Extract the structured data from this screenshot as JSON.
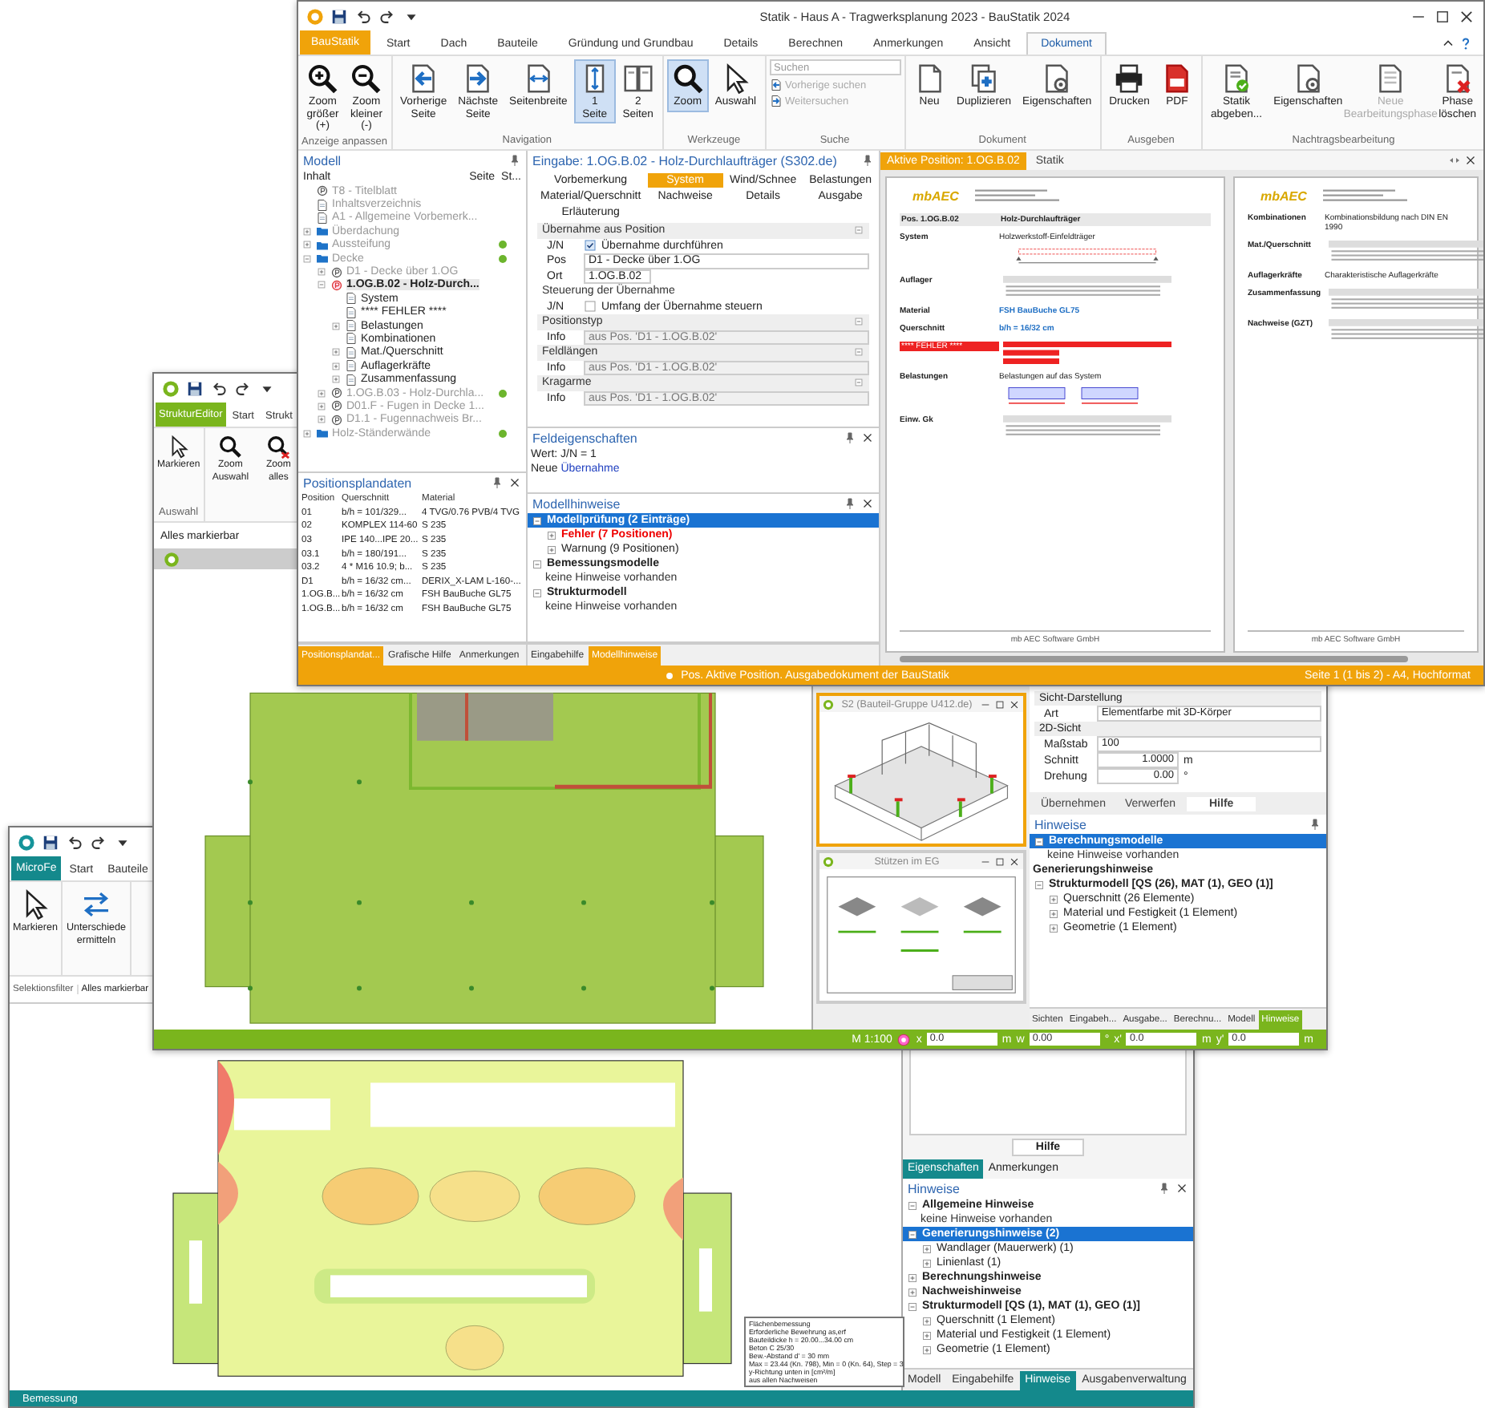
{
  "statik_window": {
    "title": "Statik - Haus A - Tragwerksplanung 2023 - BauStatik 2024",
    "app_tab": "BauStatik",
    "tabs": [
      {
        "label": "Start",
        "selected": false
      },
      {
        "label": "Dach",
        "selected": false
      },
      {
        "label": "Bauteile",
        "selected": false
      },
      {
        "label": "Gründung und Grundbau",
        "selected": false
      },
      {
        "label": "Details",
        "selected": false
      },
      {
        "label": "Berechnen",
        "selected": false
      },
      {
        "label": "Anmerkungen",
        "selected": false
      },
      {
        "label": "Ansicht",
        "selected": false
      },
      {
        "label": "Dokument",
        "selected": true
      }
    ],
    "ribbon": [
      {
        "group": "Anzeige anpassen",
        "items": [
          {
            "kind": "big",
            "label": "Zoom größer (+)",
            "selected": false,
            "disabled": false
          },
          {
            "kind": "big",
            "label": "Zoom kleiner (-)",
            "selected": false,
            "disabled": false
          }
        ]
      },
      {
        "group": "Navigation",
        "items": [
          {
            "kind": "big",
            "label": "Vorherige Seite",
            "selected": false,
            "disabled": false
          },
          {
            "kind": "big",
            "label": "Nächste Seite",
            "selected": false,
            "disabled": false
          },
          {
            "kind": "big",
            "label": "Seitenbreite",
            "selected": false,
            "disabled": false
          },
          {
            "kind": "big",
            "label": "1 Seite",
            "selected": true,
            "disabled": false
          },
          {
            "kind": "big",
            "label": "2 Seiten",
            "selected": false,
            "disabled": false
          }
        ]
      },
      {
        "group": "Werkzeuge",
        "items": [
          {
            "kind": "big",
            "label": "Zoom",
            "selected": true,
            "disabled": false
          },
          {
            "kind": "big",
            "label": "Auswahl",
            "selected": false,
            "disabled": false
          }
        ]
      },
      {
        "group": "Suche",
        "items": [
          {
            "kind": "field",
            "placeholder": "Suchen"
          },
          {
            "kind": "small",
            "label": "Vorherige suchen",
            "disabled": true
          },
          {
            "kind": "small",
            "label": "Weitersuchen",
            "disabled": true
          }
        ]
      },
      {
        "group": "Dokument",
        "items": [
          {
            "kind": "big",
            "label": "Neu",
            "selected": false,
            "disabled": false
          },
          {
            "kind": "big",
            "label": "Duplizieren",
            "selected": false,
            "disabled": false
          },
          {
            "kind": "big",
            "label": "Eigenschaften",
            "selected": false,
            "disabled": false
          }
        ]
      },
      {
        "group": "Ausgeben",
        "items": [
          {
            "kind": "big",
            "label": "Drucken",
            "selected": false,
            "disabled": false
          },
          {
            "kind": "big",
            "label": "PDF",
            "selected": false,
            "disabled": false
          }
        ]
      },
      {
        "group": "Nachtragsbearbeitung",
        "items": [
          {
            "kind": "big",
            "label": "Statik abgeben...",
            "selected": false,
            "disabled": false
          },
          {
            "kind": "big",
            "label": "Eigenschaften",
            "selected": false,
            "disabled": false
          },
          {
            "kind": "big",
            "label": "Neue Bearbeitungsphase",
            "selected": false,
            "disabled": true
          },
          {
            "kind": "big",
            "label": "Phase löschen",
            "selected": false,
            "disabled": false
          }
        ]
      }
    ],
    "model": {
      "title": "Modell",
      "columns": [
        "Inhalt",
        "Seite",
        "St..."
      ],
      "items": [
        {
          "label": "T8 - Titelblatt",
          "kind": "position",
          "dimmed": true,
          "selected": false
        },
        {
          "label": "Inhaltsverzeichnis",
          "kind": "page",
          "dimmed": true,
          "selected": false
        },
        {
          "label": "A1 - Allgemeine Vorbemerk...",
          "kind": "page",
          "dimmed": true,
          "selected": false
        },
        {
          "label": "Überdachung",
          "kind": "folder",
          "dimmed": true,
          "selected": false,
          "expanded": false
        },
        {
          "label": "Aussteifung",
          "kind": "folder",
          "dimmed": true,
          "selected": false,
          "expanded": false,
          "ok": true
        },
        {
          "label": "Decke",
          "kind": "folder",
          "dimmed": true,
          "selected": false,
          "expanded": true,
          "ok": true,
          "children": [
            {
              "label": "D1 - Decke über 1.OG",
              "kind": "position",
              "dimmed": true,
              "selected": false,
              "expanded": false
            },
            {
              "label": "1.OG.B.02 - Holz-Durch...",
              "kind": "faulty",
              "dimmed": false,
              "selected": true,
              "expanded": true,
              "children": [
                {
                  "label": "System",
                  "kind": "page",
                  "dimmed": false,
                  "selected": false
                },
                {
                  "label": "**** FEHLER ****",
                  "kind": "page",
                  "dimmed": false,
                  "selected": false
                },
                {
                  "label": "Belastungen",
                  "kind": "page",
                  "dimmed": false,
                  "selected": false,
                  "expanded": false
                },
                {
                  "label": "Kombinationen",
                  "kind": "page",
                  "dimmed": false,
                  "selected": false
                },
                {
                  "label": "Mat./Querschnitt",
                  "kind": "page",
                  "dimmed": false,
                  "selected": false,
                  "expanded": false
                },
                {
                  "label": "Auflagerkräfte",
                  "kind": "page",
                  "dimmed": false,
                  "selected": false,
                  "expanded": false
                },
                {
                  "label": "Zusammenfassung",
                  "kind": "page",
                  "dimmed": false,
                  "selected": false,
                  "expanded": false
                }
              ]
            },
            {
              "label": "1.OG.B.03 - Holz-Durchla...",
              "kind": "position",
              "dimmed": true,
              "selected": false,
              "expanded": false,
              "ok": true
            },
            {
              "label": "D01.F - Fugen in Decke 1...",
              "kind": "position",
              "dimmed": true,
              "selected": false,
              "expanded": false
            },
            {
              "label": "D1.1 - Fugennachweis Br...",
              "kind": "position",
              "dimmed": true,
              "selected": false,
              "expanded": false
            }
          ]
        },
        {
          "label": "Holz-Ständerwände",
          "kind": "folder",
          "dimmed": true,
          "selected": false,
          "expanded": false,
          "ok": true
        }
      ]
    },
    "input": {
      "title": "Eingabe: 1.OG.B.02 - Holz-Durchlaufträger (S302.de)",
      "tabs": [
        {
          "label": "Vorbemerkung",
          "selected": false
        },
        {
          "label": "System",
          "selected": true
        },
        {
          "label": "Wind/Schnee",
          "selected": false
        },
        {
          "label": "Belastungen",
          "selected": false
        },
        {
          "label": "Material/Querschnitt",
          "selected": false
        },
        {
          "label": "Nachweise",
          "selected": false
        },
        {
          "label": "Details",
          "selected": false
        },
        {
          "label": "Ausgabe",
          "selected": false
        },
        {
          "label": "Erläuterung",
          "selected": false
        }
      ],
      "sections": [
        {
          "title": "Übernahme aus Position",
          "collapsible": true,
          "rows": [
            {
              "kind": "check",
              "label": "J/N",
              "text": "Übernahme durchführen",
              "checked": true
            },
            {
              "kind": "select",
              "label": "Pos",
              "value": "D1 - Decke über 1.OG"
            },
            {
              "kind": "select-short",
              "label": "Ort",
              "value": "1.OG.B.02"
            }
          ]
        },
        {
          "title": "Steuerung der Übernahme",
          "collapsible": false,
          "rows": [
            {
              "kind": "check",
              "label": "J/N",
              "text": "Umfang der Übernahme steuern",
              "checked": false
            }
          ]
        },
        {
          "title": "Positionstyp",
          "collapsible": true,
          "rows": [
            {
              "kind": "info",
              "label": "Info",
              "value": "aus Pos. 'D1 - 1.OG.B.02'"
            }
          ]
        },
        {
          "title": "Feldlängen",
          "collapsible": true,
          "rows": [
            {
              "kind": "info",
              "label": "Info",
              "value": "aus Pos. 'D1 - 1.OG.B.02'"
            }
          ]
        },
        {
          "title": "Kragarme",
          "collapsible": true,
          "rows": [
            {
              "kind": "info",
              "label": "Info",
              "value": "aus Pos. 'D1 - 1.OG.B.02'"
            }
          ]
        }
      ]
    },
    "field_props": {
      "title": "Feldeigenschaften",
      "value_line": "Wert: J/N = 1",
      "new_prefix": "Neue",
      "new_link": "Übernahme"
    },
    "positions": {
      "title": "Positionsplandaten",
      "columns": [
        "Position",
        "Querschnitt",
        "Material"
      ],
      "rows": [
        [
          "01",
          "b/h = 101/329...",
          "4 TVG/0.76 PVB/4 TVG"
        ],
        [
          "02",
          "KOMPLEX 114-60",
          "S 235"
        ],
        [
          "03",
          "IPE 140...IPE 20...",
          "S 235"
        ],
        [
          "03.1",
          "b/h = 180/191...",
          "S 235"
        ],
        [
          "03.2",
          "4 * M16 10.9;  b...",
          "S 235"
        ],
        [
          "D1",
          "b/h = 16/32 cm...",
          "DERIX_X-LAM L-160-..."
        ],
        [
          "1.OG.B...",
          "b/h = 16/32 cm",
          "FSH BauBuche GL75"
        ],
        [
          "1.OG.B...",
          "b/h = 16/32 cm",
          "FSH BauBuche GL75"
        ]
      ]
    },
    "model_hints": {
      "title": "Modellhinweise",
      "items": [
        {
          "label": "Modellprüfung (2 Einträge)",
          "kind": "group",
          "selected": true,
          "expanded": true,
          "children": [
            {
              "label": "Fehler (7 Positionen)",
              "kind": "error",
              "selected": false,
              "expanded": false
            },
            {
              "label": "Warnung (9 Positionen)",
              "kind": "item",
              "selected": false,
              "expanded": false
            }
          ]
        },
        {
          "label": "Bemessungsmodelle",
          "kind": "group",
          "selected": false,
          "expanded": true,
          "children": [
            {
              "label": "keine Hinweise vorhanden",
              "kind": "note",
              "selected": false
            }
          ]
        },
        {
          "label": "Strukturmodell",
          "kind": "group",
          "selected": false,
          "expanded": true,
          "children": [
            {
              "label": "keine Hinweise vorhanden",
              "kind": "note",
              "selected": false
            }
          ]
        }
      ]
    },
    "left_tabs": [
      {
        "label": "Positionsplandat...",
        "selected": true
      },
      {
        "label": "Grafische Hilfe",
        "selected": false
      },
      {
        "label": "Anmerkungen",
        "selected": false
      }
    ],
    "mid_tabs": [
      {
        "label": "Eingabehilfe",
        "selected": false
      },
      {
        "label": "Modellhinweise",
        "selected": true
      }
    ],
    "doc_tabs": [
      {
        "label": "Aktive Position: 1.OG.B.02",
        "selected": true
      },
      {
        "label": "Statik",
        "selected": false
      }
    ],
    "pages": [
      {
        "logo": "mbAEC",
        "heading": "Pos. 1.OG.B.02",
        "heading_text": "Holz-Durchlaufträger",
        "footer": "mb AEC Software GmbH",
        "rows": [
          {
            "kind": "beam",
            "label": "System",
            "text": "Holzwerkstoff-Einfeldträger"
          },
          {
            "kind": "table",
            "label": "Auflager"
          },
          {
            "kind": "link",
            "label": "Material",
            "text": "FSH BauBuche GL75"
          },
          {
            "kind": "link",
            "label": "Querschnitt",
            "text": "b/h = 16/32 cm"
          },
          {
            "kind": "error",
            "label": "**** FEHLER ****"
          },
          {
            "kind": "loads",
            "label": "Belastungen",
            "text": "Belastungen auf das System"
          },
          {
            "kind": "table",
            "label": "Einw. Gk"
          }
        ]
      },
      {
        "logo": "mbAEC",
        "footer": "mb AEC Software GmbH",
        "rows": [
          {
            "kind": "text",
            "label": "Kombinationen",
            "text": "Kombinationsbildung nach DIN EN 1990"
          },
          {
            "kind": "table",
            "label": "Mat./Querschnitt"
          },
          {
            "kind": "text",
            "label": "Auflagerkräfte",
            "text": "Charakteristische Auflagerkräfte"
          },
          {
            "kind": "table",
            "label": "Zusammenfassung"
          },
          {
            "kind": "table",
            "label": "Nachweise (GZT)"
          }
        ]
      }
    ],
    "status": {
      "text": "Pos. Aktive Position. Ausgabedokument der BauStatik",
      "page_info": "Seite 1 (1 bis 2) - A4, Hochformat"
    }
  },
  "struktur_window": {
    "app_tab": "StrukturEditor",
    "tabs": [
      {
        "label": "Start",
        "selected": false
      },
      {
        "label": "Strukt",
        "selected": false
      }
    ],
    "ribbon": [
      {
        "group": "Auswahl",
        "items": [
          {
            "label": "Markieren",
            "selected": false,
            "disabled": false
          }
        ]
      },
      {
        "items": [
          {
            "label": "Zoom Auswahl",
            "selected": false,
            "disabled": false
          },
          {
            "label": "Zoom alles",
            "selected": false,
            "disabled": false
          }
        ]
      }
    ],
    "filter_value": "Alles markierbar",
    "views": [
      {
        "title": "S2 (Bauteil-Gruppe U412.de)",
        "selected": true,
        "kind": "model-3d"
      },
      {
        "title": "Stützen im EG",
        "selected": false,
        "kind": "sheet"
      }
    ],
    "props": [
      {
        "kind": "section",
        "label": "Sicht-Darstellung"
      },
      {
        "kind": "select",
        "label": "Art",
        "value": "Elementfarbe mit 3D-Körper"
      },
      {
        "kind": "section",
        "label": "2D-Sicht"
      },
      {
        "kind": "select",
        "label": "Maßstab",
        "value": "100"
      },
      {
        "kind": "number",
        "label": "Schnitt",
        "value": "1.0000",
        "unit": "m"
      },
      {
        "kind": "number",
        "label": "Drehung",
        "value": "0.00",
        "unit": "°"
      }
    ],
    "actions": [
      {
        "label": "Übernehmen",
        "default": false
      },
      {
        "label": "Verwerfen",
        "default": false
      },
      {
        "label": "Hilfe",
        "default": true
      }
    ],
    "hints": {
      "title": "Hinweise",
      "items": [
        {
          "label": "Berechnungsmodelle",
          "kind": "group",
          "selected": true,
          "expanded": true,
          "children": [
            {
              "label": "keine Hinweise vorhanden",
              "kind": "note",
              "selected": false
            }
          ]
        },
        {
          "label": "Generierungshinweise",
          "kind": "group",
          "selected": false
        },
        {
          "label": "Strukturmodell [QS (26), MAT (1), GEO (1)]",
          "kind": "group",
          "selected": false,
          "expanded": true,
          "children": [
            {
              "label": "Querschnitt (26 Elemente)",
              "kind": "item",
              "selected": false,
              "expanded": false
            },
            {
              "label": "Material und Festigkeit (1 Element)",
              "kind": "item",
              "selected": false,
              "expanded": false
            },
            {
              "label": "Geometrie (1 Element)",
              "kind": "item",
              "selected": false,
              "expanded": false
            }
          ]
        }
      ]
    },
    "bottom_tabs": [
      {
        "label": "Sichten",
        "selected": false
      },
      {
        "label": "Eingabeh...",
        "selected": false
      },
      {
        "label": "Ausgabe...",
        "selected": false
      },
      {
        "label": "Berechnu...",
        "selected": false
      },
      {
        "label": "Modell",
        "selected": false
      },
      {
        "label": "Hinweise",
        "selected": true
      }
    ],
    "status": {
      "scale": "M 1:100",
      "coords": [
        {
          "label": "x",
          "value": "0.0",
          "unit": "m"
        },
        {
          "label": "w",
          "value": "0.00",
          "unit": "°"
        },
        {
          "label": "x'",
          "value": "0.0",
          "unit": "m"
        },
        {
          "label": "y'",
          "value": "0.0",
          "unit": "m"
        }
      ]
    }
  },
  "microfe_window": {
    "app_tab": "MicroFe",
    "tabs": [
      {
        "label": "Start",
        "selected": false
      },
      {
        "label": "Bauteile",
        "selected": false
      }
    ],
    "ribbon": [
      {
        "items": [
          {
            "label": "Markieren",
            "selected": false,
            "disabled": false
          }
        ]
      },
      {
        "items": [
          {
            "label": "Unterschiede ermitteln",
            "selected": false,
            "disabled": false
          }
        ]
      }
    ],
    "filter_label": "Selektionsfilter",
    "filter_value": "Alles markierbar",
    "legend": [
      "Flächenbemessung",
      "Erforderliche Bewehrung as,erf",
      "Bauteildicke h = 20.00...34.00 cm",
      "Beton C 25/30",
      "Bew.-Abstand d' = 30 mm",
      "Max = 23.44 (Kn. 798), Min = 0 (Kn. 64), Step = 3",
      "y-Richtung unten in [cm²/m]",
      "aus allen Nachweisen"
    ],
    "help_button": "Hilfe",
    "panel_tabs": [
      {
        "label": "Eigenschaften",
        "selected": true
      },
      {
        "label": "Anmerkungen",
        "selected": false
      }
    ],
    "hints": {
      "title": "Hinweise",
      "items": [
        {
          "label": "Allgemeine Hinweise",
          "kind": "group",
          "selected": false,
          "expanded": true,
          "children": [
            {
              "label": "keine Hinweise vorhanden",
              "kind": "note",
              "selected": false
            }
          ]
        },
        {
          "label": "Generierungshinweise (2)",
          "kind": "group",
          "selected": true,
          "expanded": true,
          "children": [
            {
              "label": "Wandlager (Mauerwerk) (1)",
              "kind": "item",
              "selected": false,
              "expanded": false
            },
            {
              "label": "Linienlast (1)",
              "kind": "item",
              "selected": false,
              "expanded": false
            }
          ]
        },
        {
          "label": "Berechnungshinweise",
          "kind": "group",
          "selected": false,
          "expanded": false
        },
        {
          "label": "Nachweishinweise",
          "kind": "group",
          "selected": false,
          "expanded": false
        },
        {
          "label": "Strukturmodell [QS (1), MAT (1), GEO (1)]",
          "kind": "group",
          "selected": false,
          "expanded": true,
          "children": [
            {
              "label": "Querschnitt (1 Element)",
              "kind": "item",
              "selected": false,
              "expanded": false
            },
            {
              "label": "Material und Festigkeit (1 Element)",
              "kind": "item",
              "selected": false,
              "expanded": false
            },
            {
              "label": "Geometrie (1 Element)",
              "kind": "item",
              "selected": false,
              "expanded": false
            }
          ]
        }
      ]
    },
    "bottom_tabs": [
      {
        "label": "Modell",
        "selected": false
      },
      {
        "label": "Eingabehilfe",
        "selected": false
      },
      {
        "label": "Hinweise",
        "selected": true
      },
      {
        "label": "Ausgabenverwaltung",
        "selected": false
      }
    ],
    "status": "Bemessung"
  }
}
